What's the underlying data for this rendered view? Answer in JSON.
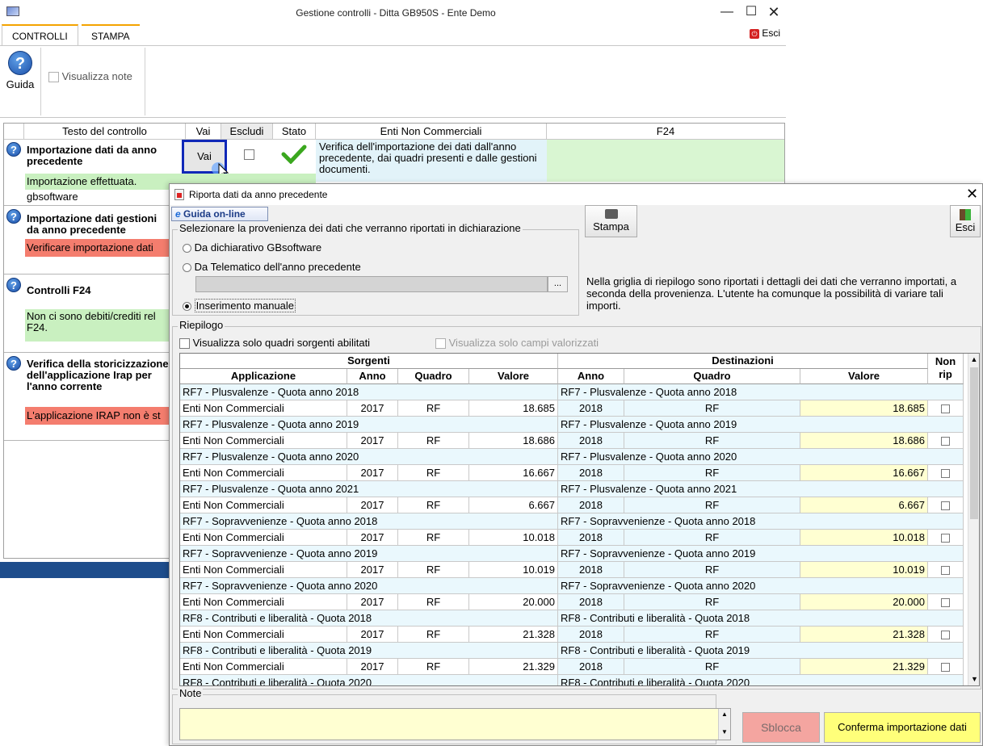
{
  "main_window": {
    "title": "Gestione controlli - Ditta GB950S - Ente Demo",
    "tabs": [
      {
        "label": "CONTROLLI"
      },
      {
        "label": "STAMPA"
      }
    ],
    "esci_label": "Esci",
    "ribbon": {
      "help_label": "Guida",
      "note_checkbox_label": "Visualizza note"
    },
    "grid_headers": {
      "testo": "Testo del controllo",
      "vai": "Vai",
      "escludi": "Escludi",
      "stato": "Stato",
      "enti": "Enti Non Commerciali",
      "f24": "F24"
    },
    "controls": [
      {
        "title": "Importazione dati da anno precedente",
        "status_text": "Importazione effettuata.",
        "extra": "gbsoftware",
        "vai_label": "Vai",
        "description": "Verifica dell'importazione dei dati dall'anno precedente, dai quadri presenti e dalle gestioni documenti."
      },
      {
        "title": "Importazione dati gestioni da anno precedente",
        "status_text": "Verificare importazione dati"
      },
      {
        "title": "Controlli F24",
        "status_text": "Non ci sono debiti/crediti rel F24."
      },
      {
        "title": "Verifica della storicizzazione dell'applicazione Irap per l'anno corrente",
        "status_text": "L'applicazione IRAP non è st"
      }
    ]
  },
  "dialog": {
    "title": "Riporta dati da anno precedente",
    "guida_online_label": "Guida on-line",
    "stampa_label": "Stampa",
    "esci_label": "Esci",
    "provenienza": {
      "legend": "Selezionare la provenienza dei dati che verranno riportati in dichiarazione",
      "options": [
        {
          "label": "Da dichiarativo GBsoftware",
          "selected": false
        },
        {
          "label": "Da Telematico dell'anno precedente",
          "selected": false
        },
        {
          "label": "Inserimento manuale",
          "selected": true
        }
      ],
      "browse_label": "..."
    },
    "info_text": "Nella griglia di riepilogo sono riportati i dettagli dei dati che verranno importati, a seconda della provenienza. L'utente ha comunque la possibilità di variare tali importi.",
    "riepilogo": {
      "legend": "Riepilogo",
      "chk_sorgenti": "Visualizza solo quadri sorgenti abilitati",
      "chk_campi": "Visualizza solo campi valorizzati",
      "group_headers": {
        "sorgenti": "Sorgenti",
        "destinazioni": "Destinazioni",
        "non_rip": "Non rip"
      },
      "col_headers": {
        "applicazione": "Applicazione",
        "anno": "Anno",
        "quadro": "Quadro",
        "valore": "Valore",
        "anno_dest": "Anno",
        "quadro_dest": "Quadro",
        "valore_dest": "Valore"
      },
      "rows": [
        {
          "src_title": "RF7 - Plusvalenze  - Quota anno 2018",
          "dest_title": "RF7 - Plusvalenze  - Quota anno 2018",
          "app": "Enti Non Commerciali",
          "anno": "2017",
          "quadro": "RF",
          "valore": "18.685",
          "anno_dest": "2018",
          "quadro_dest": "RF",
          "valore_dest": "18.685"
        },
        {
          "src_title": "RF7 - Plusvalenze  - Quota anno 2019",
          "dest_title": "RF7 - Plusvalenze  - Quota anno 2019",
          "app": "Enti Non Commerciali",
          "anno": "2017",
          "quadro": "RF",
          "valore": "18.686",
          "anno_dest": "2018",
          "quadro_dest": "RF",
          "valore_dest": "18.686"
        },
        {
          "src_title": "RF7 - Plusvalenze  - Quota anno 2020",
          "dest_title": "RF7 - Plusvalenze  - Quota anno 2020",
          "app": "Enti Non Commerciali",
          "anno": "2017",
          "quadro": "RF",
          "valore": "16.667",
          "anno_dest": "2018",
          "quadro_dest": "RF",
          "valore_dest": "16.667"
        },
        {
          "src_title": "RF7 - Plusvalenze  - Quota anno 2021",
          "dest_title": "RF7 - Plusvalenze  - Quota anno 2021",
          "app": "Enti Non Commerciali",
          "anno": "2017",
          "quadro": "RF",
          "valore": "6.667",
          "anno_dest": "2018",
          "quadro_dest": "RF",
          "valore_dest": "6.667"
        },
        {
          "src_title": "RF7 - Sopravvenienze - Quota anno 2018",
          "dest_title": "RF7 - Sopravvenienze - Quota anno 2018",
          "app": "Enti Non Commerciali",
          "anno": "2017",
          "quadro": "RF",
          "valore": "10.018",
          "anno_dest": "2018",
          "quadro_dest": "RF",
          "valore_dest": "10.018"
        },
        {
          "src_title": "RF7 - Sopravvenienze - Quota anno 2019",
          "dest_title": "RF7 - Sopravvenienze - Quota anno 2019",
          "app": "Enti Non Commerciali",
          "anno": "2017",
          "quadro": "RF",
          "valore": "10.019",
          "anno_dest": "2018",
          "quadro_dest": "RF",
          "valore_dest": "10.019"
        },
        {
          "src_title": "RF7 - Sopravvenienze - Quota anno 2020",
          "dest_title": "RF7 - Sopravvenienze - Quota anno 2020",
          "app": "Enti Non Commerciali",
          "anno": "2017",
          "quadro": "RF",
          "valore": "20.000",
          "anno_dest": "2018",
          "quadro_dest": "RF",
          "valore_dest": "20.000"
        },
        {
          "src_title": "RF8 - Contributi e liberalità - Quota 2018",
          "dest_title": "RF8 - Contributi e liberalità - Quota 2018",
          "app": "Enti Non Commerciali",
          "anno": "2017",
          "quadro": "RF",
          "valore": "21.328",
          "anno_dest": "2018",
          "quadro_dest": "RF",
          "valore_dest": "21.328"
        },
        {
          "src_title": "RF8 - Contributi e liberalità - Quota 2019",
          "dest_title": "RF8 - Contributi e liberalità - Quota 2019",
          "app": "Enti Non Commerciali",
          "anno": "2017",
          "quadro": "RF",
          "valore": "21.329",
          "anno_dest": "2018",
          "quadro_dest": "RF",
          "valore_dest": "21.329"
        }
      ],
      "partial_row": {
        "src_title": "RF8 - Contributi e liberalità - Quota 2020",
        "dest_title": "RF8 - Contributi e liberalità - Quota 2020"
      }
    },
    "note_legend": "Note",
    "sblocca_label": "Sblocca",
    "conferma_label": "Conferma importazione dati"
  }
}
